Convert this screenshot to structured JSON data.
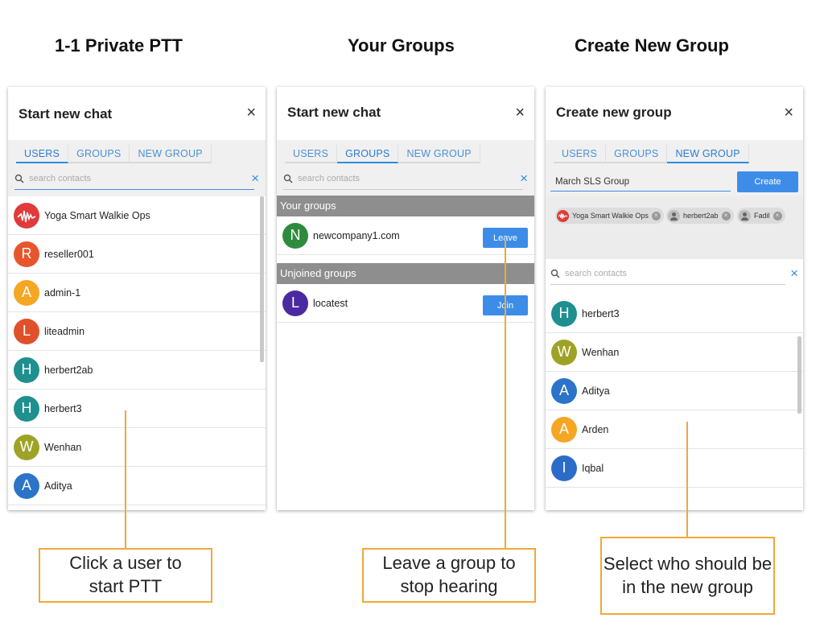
{
  "headings": {
    "private": "1-1 Private PTT",
    "groups": "Your Groups",
    "create": "Create New Group"
  },
  "panel1": {
    "title": "Start new chat",
    "close": "×",
    "tabs": [
      "USERS",
      "GROUPS",
      "NEW GROUP"
    ],
    "active_tab": "USERS",
    "search_placeholder": "search contacts",
    "contacts": [
      {
        "name": "Yoga Smart Walkie Ops",
        "initial": "",
        "color": "#e03a3a"
      },
      {
        "name": "reseller001",
        "initial": "R",
        "color": "#e8552c"
      },
      {
        "name": "admin-1",
        "initial": "A",
        "color": "#f5a623"
      },
      {
        "name": "liteadmin",
        "initial": "L",
        "color": "#e0502a"
      },
      {
        "name": "herbert2ab",
        "initial": "H",
        "color": "#1f8f8f"
      },
      {
        "name": "herbert3",
        "initial": "H",
        "color": "#1f8f8f"
      },
      {
        "name": "Wenhan",
        "initial": "W",
        "color": "#9fa325"
      },
      {
        "name": "Aditya",
        "initial": "A",
        "color": "#2b74c8"
      }
    ]
  },
  "panel2": {
    "title": "Start new chat",
    "close": "×",
    "tabs": [
      "USERS",
      "GROUPS",
      "NEW GROUP"
    ],
    "active_tab": "GROUPS",
    "search_placeholder": "search contacts",
    "your_groups_label": "Your groups",
    "your_groups": [
      {
        "name": "newcompany1.com",
        "initial": "N",
        "color": "#2e8b3e",
        "action": "Leave"
      }
    ],
    "unjoined_label": "Unjoined groups",
    "unjoined_groups": [
      {
        "name": "locatest",
        "initial": "L",
        "color": "#4a2aa0",
        "action": "Join"
      }
    ]
  },
  "panel3": {
    "title": "Create new group",
    "close": "×",
    "tabs": [
      "USERS",
      "GROUPS",
      "NEW GROUP"
    ],
    "active_tab": "NEW GROUP",
    "group_name": "March SLS Group",
    "create_label": "Create",
    "chips": [
      "Yoga Smart Walkie Ops",
      "herbert2ab",
      "Fadil"
    ],
    "search_placeholder": "search contacts",
    "contacts": [
      {
        "name": "herbert3",
        "initial": "H",
        "color": "#1f8f8f"
      },
      {
        "name": "Wenhan",
        "initial": "W",
        "color": "#9fa325"
      },
      {
        "name": "Aditya",
        "initial": "A",
        "color": "#2b74c8"
      },
      {
        "name": "Arden",
        "initial": "A",
        "color": "#f5a623"
      },
      {
        "name": "Iqbal",
        "initial": "I",
        "color": "#2b6cc8"
      }
    ]
  },
  "callouts": {
    "c1": "Click a user to start PTT",
    "c2": "Leave a group to stop hearing",
    "c3": "Select who should be in the new group"
  },
  "colors": {
    "accent": "#3d8de8",
    "callout": "#f0a838",
    "section": "#8e8e8e"
  }
}
